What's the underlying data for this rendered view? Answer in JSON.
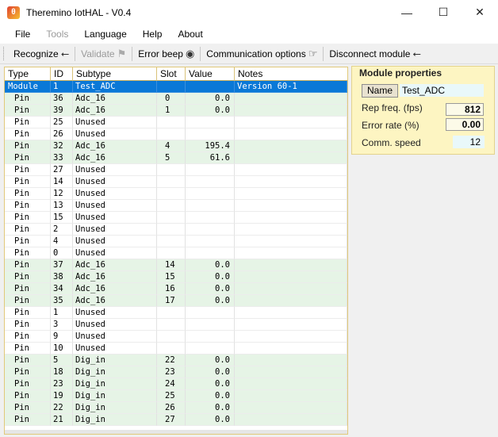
{
  "window": {
    "title": "Theremino IotHAL - V0.4"
  },
  "menu": [
    {
      "label": "File",
      "disabled": false
    },
    {
      "label": "Tools",
      "disabled": true
    },
    {
      "label": "Language",
      "disabled": false
    },
    {
      "label": "Help",
      "disabled": false
    },
    {
      "label": "About",
      "disabled": false
    }
  ],
  "toolbar": {
    "recognize": "Recognize",
    "validate": "Validate",
    "error_beep": "Error beep",
    "comm_options": "Communication options",
    "disconnect": "Disconnect module"
  },
  "grid": {
    "headers": [
      "Type",
      "ID",
      "Subtype",
      "Slot",
      "Value",
      "Notes"
    ],
    "rows": [
      {
        "type": "Module",
        "id": "1",
        "subtype": "Test_ADC",
        "slot": "",
        "value": "",
        "notes": "Version 60-1",
        "kind": "module"
      },
      {
        "type": "Pin",
        "id": "36",
        "subtype": "Adc_16",
        "slot": "0",
        "value": "0.0",
        "notes": "",
        "kind": "used"
      },
      {
        "type": "Pin",
        "id": "39",
        "subtype": "Adc_16",
        "slot": "1",
        "value": "0.0",
        "notes": "",
        "kind": "used"
      },
      {
        "type": "Pin",
        "id": "25",
        "subtype": "Unused",
        "slot": "",
        "value": "",
        "notes": "",
        "kind": "unused"
      },
      {
        "type": "Pin",
        "id": "26",
        "subtype": "Unused",
        "slot": "",
        "value": "",
        "notes": "",
        "kind": "unused"
      },
      {
        "type": "Pin",
        "id": "32",
        "subtype": "Adc_16",
        "slot": "4",
        "value": "195.4",
        "notes": "",
        "kind": "used"
      },
      {
        "type": "Pin",
        "id": "33",
        "subtype": "Adc_16",
        "slot": "5",
        "value": "61.6",
        "notes": "",
        "kind": "used"
      },
      {
        "type": "Pin",
        "id": "27",
        "subtype": "Unused",
        "slot": "",
        "value": "",
        "notes": "",
        "kind": "unused"
      },
      {
        "type": "Pin",
        "id": "14",
        "subtype": "Unused",
        "slot": "",
        "value": "",
        "notes": "",
        "kind": "unused"
      },
      {
        "type": "Pin",
        "id": "12",
        "subtype": "Unused",
        "slot": "",
        "value": "",
        "notes": "",
        "kind": "unused"
      },
      {
        "type": "Pin",
        "id": "13",
        "subtype": "Unused",
        "slot": "",
        "value": "",
        "notes": "",
        "kind": "unused"
      },
      {
        "type": "Pin",
        "id": "15",
        "subtype": "Unused",
        "slot": "",
        "value": "",
        "notes": "",
        "kind": "unused"
      },
      {
        "type": "Pin",
        "id": "2",
        "subtype": "Unused",
        "slot": "",
        "value": "",
        "notes": "",
        "kind": "unused"
      },
      {
        "type": "Pin",
        "id": "4",
        "subtype": "Unused",
        "slot": "",
        "value": "",
        "notes": "",
        "kind": "unused"
      },
      {
        "type": "Pin",
        "id": "0",
        "subtype": "Unused",
        "slot": "",
        "value": "",
        "notes": "",
        "kind": "unused"
      },
      {
        "type": "Pin",
        "id": "37",
        "subtype": "Adc_16",
        "slot": "14",
        "value": "0.0",
        "notes": "",
        "kind": "used"
      },
      {
        "type": "Pin",
        "id": "38",
        "subtype": "Adc_16",
        "slot": "15",
        "value": "0.0",
        "notes": "",
        "kind": "used"
      },
      {
        "type": "Pin",
        "id": "34",
        "subtype": "Adc_16",
        "slot": "16",
        "value": "0.0",
        "notes": "",
        "kind": "used"
      },
      {
        "type": "Pin",
        "id": "35",
        "subtype": "Adc_16",
        "slot": "17",
        "value": "0.0",
        "notes": "",
        "kind": "used"
      },
      {
        "type": "Pin",
        "id": "1",
        "subtype": "Unused",
        "slot": "",
        "value": "",
        "notes": "",
        "kind": "unused"
      },
      {
        "type": "Pin",
        "id": "3",
        "subtype": "Unused",
        "slot": "",
        "value": "",
        "notes": "",
        "kind": "unused"
      },
      {
        "type": "Pin",
        "id": "9",
        "subtype": "Unused",
        "slot": "",
        "value": "",
        "notes": "",
        "kind": "unused"
      },
      {
        "type": "Pin",
        "id": "10",
        "subtype": "Unused",
        "slot": "",
        "value": "",
        "notes": "",
        "kind": "unused"
      },
      {
        "type": "Pin",
        "id": "5",
        "subtype": "Dig_in",
        "slot": "22",
        "value": "0.0",
        "notes": "",
        "kind": "used"
      },
      {
        "type": "Pin",
        "id": "18",
        "subtype": "Dig_in",
        "slot": "23",
        "value": "0.0",
        "notes": "",
        "kind": "used"
      },
      {
        "type": "Pin",
        "id": "23",
        "subtype": "Dig_in",
        "slot": "24",
        "value": "0.0",
        "notes": "",
        "kind": "used"
      },
      {
        "type": "Pin",
        "id": "19",
        "subtype": "Dig_in",
        "slot": "25",
        "value": "0.0",
        "notes": "",
        "kind": "used"
      },
      {
        "type": "Pin",
        "id": "22",
        "subtype": "Dig_in",
        "slot": "26",
        "value": "0.0",
        "notes": "",
        "kind": "used"
      },
      {
        "type": "Pin",
        "id": "21",
        "subtype": "Dig_in",
        "slot": "27",
        "value": "0.0",
        "notes": "",
        "kind": "used"
      }
    ]
  },
  "properties": {
    "title": "Module properties",
    "name_button": "Name",
    "name_value": "Test_ADC",
    "rep_freq_label": "Rep freq. (fps)",
    "rep_freq_value": "812",
    "error_rate_label": "Error rate (%)",
    "error_rate_value": "0.00",
    "comm_speed_label": "Comm. speed",
    "comm_speed_value": "12"
  }
}
